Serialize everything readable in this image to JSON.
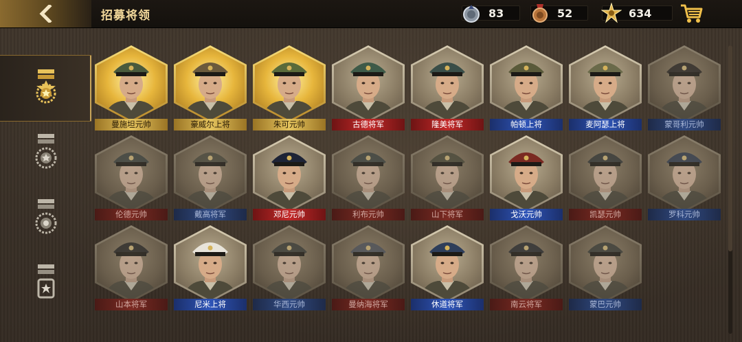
{
  "header": {
    "title": "招募将领",
    "back_icon": "chevron-left-icon",
    "cart_icon": "cart-icon"
  },
  "resources": [
    {
      "icon": "silver-medal-icon",
      "value": "83"
    },
    {
      "icon": "bronze-medal-icon",
      "value": "52"
    },
    {
      "icon": "gold-star-icon",
      "value": "634"
    }
  ],
  "sidebar": {
    "items": [
      {
        "icon": "gold-rank-medal-icon",
        "active": true
      },
      {
        "icon": "silver-rank-medal-icon",
        "active": false
      },
      {
        "icon": "silver-rank-medal-2-icon",
        "active": false
      },
      {
        "icon": "bronze-rank-medal-icon",
        "active": false
      }
    ]
  },
  "colors": {
    "accent_gold": "#c9a55a",
    "title_gold": "#f1d79a",
    "axis_red": "#c32828",
    "allies_blue": "#2f55b8"
  },
  "generals": [
    {
      "name": "曼施坦元帅",
      "frame": "gold",
      "tag": "gold",
      "cap": "#4a5a3c"
    },
    {
      "name": "豪威尔上将",
      "frame": "gold",
      "tag": "gold",
      "cap": "#6b5a3c"
    },
    {
      "name": "朱可元帅",
      "frame": "gold",
      "tag": "gold",
      "cap": "#5a6a3a"
    },
    {
      "name": "古德将军",
      "frame": "normal",
      "tag": "red",
      "cap": "#3e5a48"
    },
    {
      "name": "隆美将军",
      "frame": "normal",
      "tag": "red",
      "cap": "#3a4e48"
    },
    {
      "name": "帕顿上将",
      "frame": "normal",
      "tag": "blue",
      "cap": "#5a5a3a"
    },
    {
      "name": "麦阿瑟上将",
      "frame": "normal",
      "tag": "blue",
      "cap": "#6a6a4a"
    },
    {
      "name": "蒙哥利元帅",
      "frame": "dim",
      "tag": "blue-dim",
      "cap": "#2e2a26"
    },
    {
      "name": "伦德元帅",
      "frame": "dim",
      "tag": "red-dim",
      "cap": "#3a4440"
    },
    {
      "name": "戴高将军",
      "frame": "dim",
      "tag": "blue-dim",
      "cap": "#4a4a3a"
    },
    {
      "name": "邓尼元帅",
      "frame": "normal",
      "tag": "red",
      "cap": "#1e2436"
    },
    {
      "name": "利布元帅",
      "frame": "dim",
      "tag": "red-dim",
      "cap": "#3a4440"
    },
    {
      "name": "山下将军",
      "frame": "dim",
      "tag": "red-dim",
      "cap": "#4a4a32"
    },
    {
      "name": "戈沃元帅",
      "frame": "normal",
      "tag": "blue",
      "cap": "#7a2a22"
    },
    {
      "name": "凯瑟元帅",
      "frame": "dim",
      "tag": "red-dim",
      "cap": "#34383a"
    },
    {
      "name": "罗科元帅",
      "frame": "dim",
      "tag": "blue-dim",
      "cap": "#2e3e5a"
    },
    {
      "name": "山本将军",
      "frame": "dim",
      "tag": "red-dim",
      "cap": "#2a2a2a"
    },
    {
      "name": "尼米上将",
      "frame": "normal",
      "tag": "blue",
      "cap": "#e8e4da"
    },
    {
      "name": "华西元帅",
      "frame": "dim",
      "tag": "blue-dim",
      "cap": "#3a3e38"
    },
    {
      "name": "曼纳海将军",
      "frame": "dim",
      "tag": "red-dim",
      "cap": "#4a5260"
    },
    {
      "name": "休道将军",
      "frame": "normal",
      "tag": "blue",
      "cap": "#2e3e5a"
    },
    {
      "name": "南云将军",
      "frame": "dim",
      "tag": "red-dim",
      "cap": "#2a2e34"
    },
    {
      "name": "蒙巴元帅",
      "frame": "dim",
      "tag": "blue-dim",
      "cap": "#3a3e38"
    }
  ]
}
